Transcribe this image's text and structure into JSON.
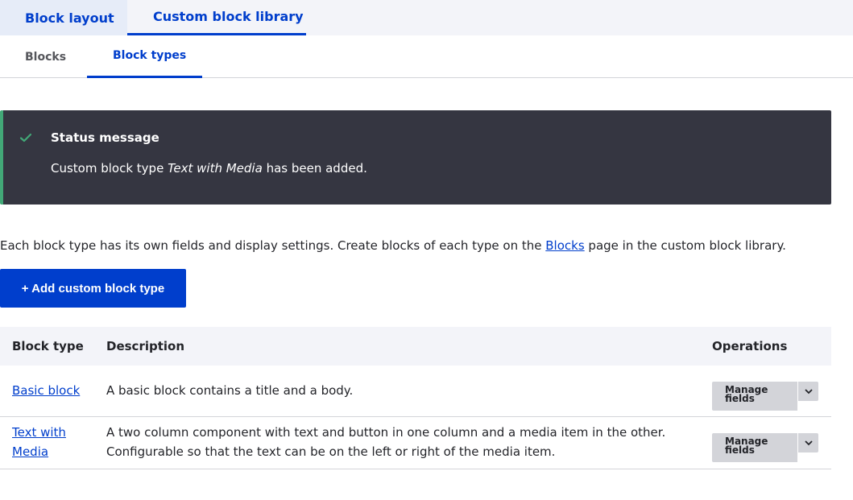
{
  "primary_tabs": [
    {
      "label": "Block layout"
    },
    {
      "label": "Custom block library"
    }
  ],
  "secondary_tabs": [
    {
      "label": "Blocks"
    },
    {
      "label": "Block types"
    }
  ],
  "status": {
    "title": "Status message",
    "text_before": "Custom block type ",
    "text_emphasis": "Text with Media",
    "text_after": " has been added.",
    "icon": "check-icon",
    "accent_color": "#42a877"
  },
  "description": {
    "before": "Each block type has its own fields and display settings. Create blocks of each type on the ",
    "link": "Blocks",
    "after": " page in the custom block library."
  },
  "add_button": {
    "label": "+ Add custom block type"
  },
  "table": {
    "headers": [
      "Block type",
      "Description",
      "Operations"
    ],
    "rows": [
      {
        "name": "Basic block",
        "description": "A basic block contains a title and a body.",
        "operation": "Manage fields"
      },
      {
        "name": "Text with Media",
        "description": "A two column component with text and button in one column and a media item in the other. Configurable so that the text can be on the left or right of the media item.",
        "operation": "Manage fields"
      }
    ]
  },
  "colors": {
    "primary": "#003ecc",
    "status_bg": "#353641"
  }
}
